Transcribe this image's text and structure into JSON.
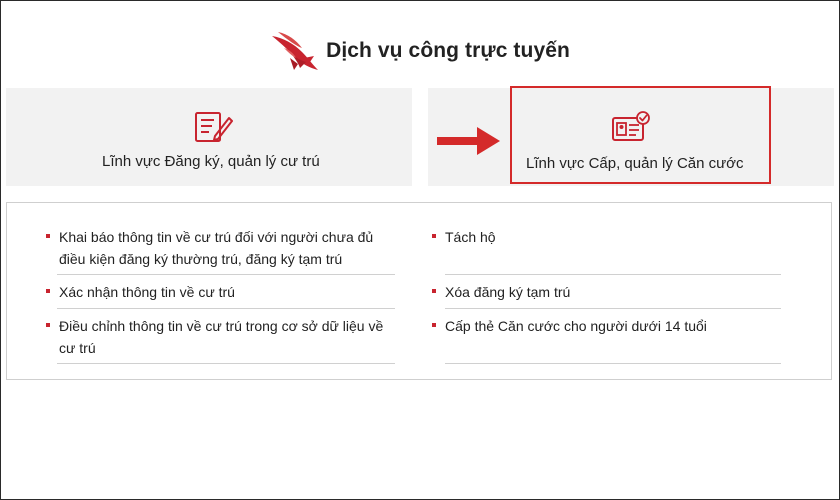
{
  "header": {
    "title": "Dịch vụ công trực tuyến",
    "logo_icon": "red-bird-logo-icon"
  },
  "categories": [
    {
      "label": "Lĩnh vực Đăng ký, quản lý cư trú",
      "icon": "form-edit-icon"
    },
    {
      "label": "Lĩnh vực Cấp, quản lý Căn cước",
      "icon": "id-card-check-icon"
    }
  ],
  "services": {
    "left": [
      {
        "text": "Khai báo thông tin về cư trú đối với người chưa đủ điều kiện đăng ký thường trú, đăng ký tạm trú"
      },
      {
        "text": "Xác nhận thông tin về cư trú"
      },
      {
        "text": "Điều chỉnh thông tin về cư trú trong cơ sở dữ liệu về cư trú"
      }
    ],
    "right": [
      {
        "text": "Tách hộ"
      },
      {
        "text": "Xóa đăng ký tạm trú"
      },
      {
        "text": "Cấp thẻ Căn cước cho người dưới 14 tuổi"
      }
    ]
  },
  "colors": {
    "accent": "#d42a2a",
    "bullet": "#c8242f",
    "card_bg": "#f2f2f2"
  }
}
